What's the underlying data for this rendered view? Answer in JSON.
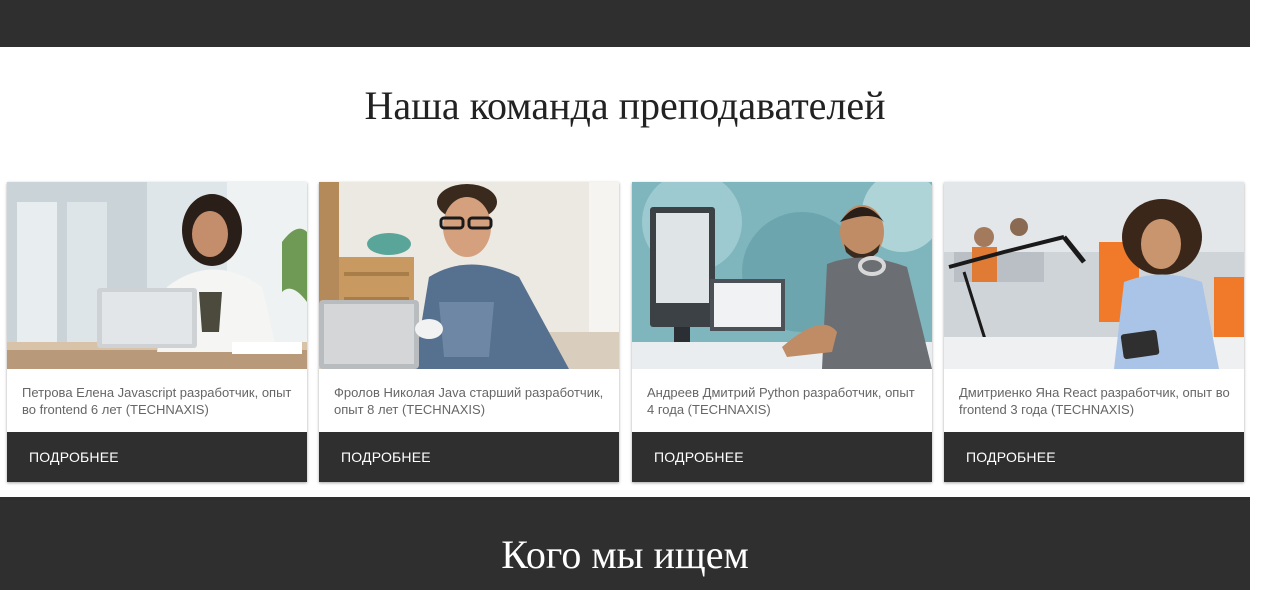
{
  "header": {},
  "team_section": {
    "title": "Наша команда преподавателей",
    "cards": [
      {
        "photo": "teacher-photo-woman-laptop",
        "description": "Петрова Елена Javascript разработчик, опыт во frontend 6 лет (TECHNAXIS)",
        "link_label": "ПОДРОБНЕЕ"
      },
      {
        "photo": "teacher-photo-man-glasses-laptop",
        "description": "Фролов Николая Java старший разработчик, опыт 8 лет (TECHNAXIS)",
        "link_label": "ПОДРОБНЕЕ"
      },
      {
        "photo": "teacher-photo-man-headphones-computer",
        "description": "Андреев Дмитрий Python разработчик, опыт 4 года (TECHNAXIS)",
        "link_label": "ПОДРОБНЕЕ"
      },
      {
        "photo": "teacher-photo-woman-tablet-office",
        "description": "Дмитриенко Яна React разработчик, опыт во frontend 3 года (TECHNAXIS)",
        "link_label": "ПОДРОБНЕЕ"
      }
    ]
  },
  "search_section": {
    "title": "Кого мы ищем"
  },
  "colors": {
    "dark": "#2f2f2f",
    "text": "#666666",
    "title": "#222222"
  }
}
